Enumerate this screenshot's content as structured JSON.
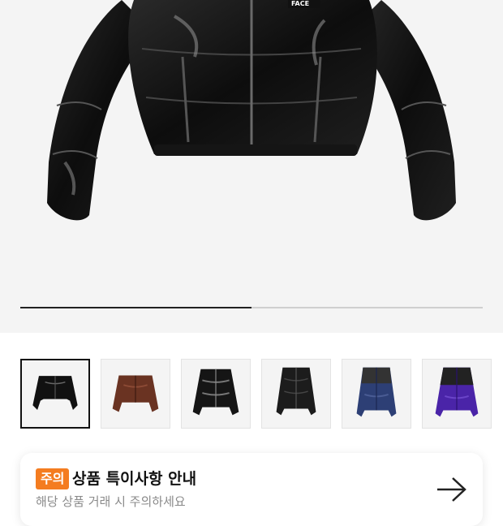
{
  "gallery": {
    "brand_logo_text": "FACE",
    "progress_fraction": 0.5,
    "thumbnails": [
      {
        "name": "thumb-black-glossy",
        "active": true
      },
      {
        "name": "thumb-brown",
        "active": false
      },
      {
        "name": "thumb-black-shiny",
        "active": false
      },
      {
        "name": "thumb-black-matte",
        "active": false
      },
      {
        "name": "thumb-navy",
        "active": false
      },
      {
        "name": "thumb-purple",
        "active": false
      }
    ]
  },
  "notice": {
    "badge": "주의",
    "title": "상품 특이사항 안내",
    "subtitle": "해당 상품 거래 시 주의하세요",
    "arrow_icon": "arrow-right-icon"
  },
  "colors": {
    "badge_bg": "#f47c20",
    "progress": "#222222"
  }
}
